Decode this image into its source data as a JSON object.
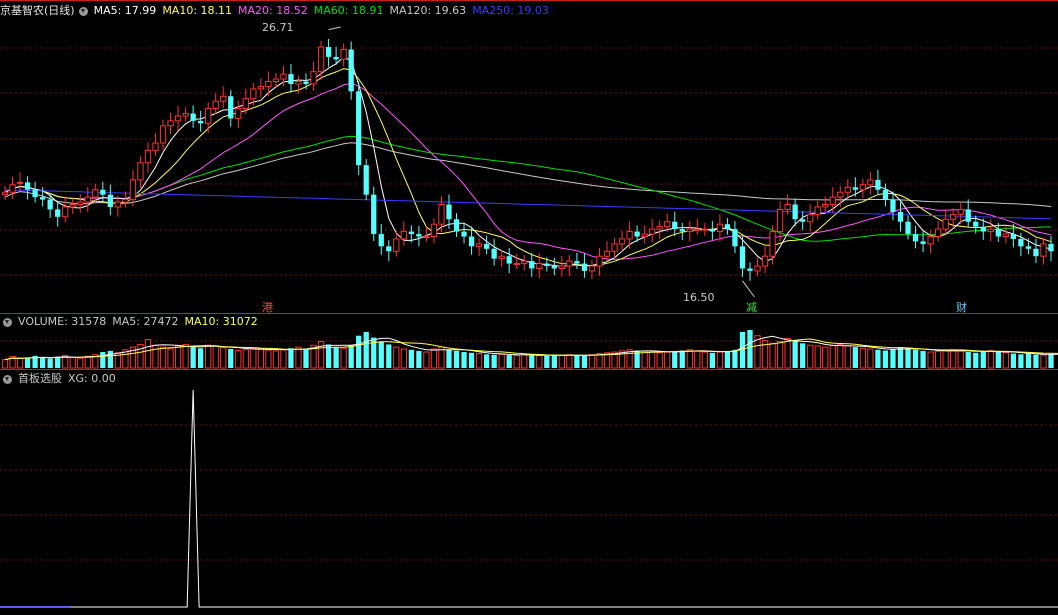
{
  "header": {
    "stock_name": "京基智农",
    "period": "(日线)",
    "ma5": "MA5: 17.99",
    "ma10": "MA10: 18.11",
    "ma20": "MA20: 18.52",
    "ma60": "MA60: 18.91",
    "ma120": "MA120: 19.63",
    "ma250": "MA250: 19.03"
  },
  "volume_header": {
    "volume": "VOLUME: 31578",
    "ma5": "MA5: 27472",
    "ma10": "MA10: 31072"
  },
  "indicator_header": {
    "name": "首板选股",
    "xg": "XG: 0.00"
  },
  "annotations": {
    "high_label": "26.71",
    "low_label": "16.50",
    "marker_1": "港",
    "marker_2": "减",
    "marker_3": "财"
  },
  "colors": {
    "up": "#ff3232",
    "down": "#54ffff",
    "ma5": "#ffffff",
    "ma10": "#ffff55",
    "ma20": "#ff55ff",
    "ma60": "#00e000",
    "ma120": "#c8c8c8",
    "ma250": "#3c3cff",
    "grid": "#7a1010",
    "panel_border": "#c81e1e"
  },
  "chart_data": [
    {
      "type": "candlestick",
      "title": "京基智农 (日线)",
      "ylim": [
        15.8,
        27.1
      ],
      "grid": true,
      "annotations": [
        {
          "label": "26.71",
          "value": 26.71
        },
        {
          "label": "16.50",
          "value": 16.5
        }
      ],
      "moving_averages": [
        {
          "name": "MA5",
          "value": 17.99
        },
        {
          "name": "MA10",
          "value": 18.11
        },
        {
          "name": "MA20",
          "value": 18.52
        },
        {
          "name": "MA60",
          "value": 18.91
        },
        {
          "name": "MA120",
          "value": 19.63
        },
        {
          "name": "MA250",
          "value": 19.03
        }
      ],
      "close": [
        20.1,
        20.4,
        20.5,
        20.2,
        19.9,
        19.8,
        19.4,
        19.1,
        19.5,
        19.6,
        19.7,
        19.9,
        20.2,
        20.0,
        19.5,
        19.7,
        19.8,
        20.6,
        21.3,
        21.8,
        22.1,
        22.8,
        23.0,
        23.2,
        23.3,
        23.0,
        22.9,
        23.5,
        23.8,
        24.0,
        23.1,
        23.5,
        23.9,
        24.3,
        24.4,
        24.6,
        24.7,
        24.9,
        24.5,
        24.6,
        24.5,
        25.0,
        26.0,
        25.6,
        25.5,
        25.9,
        24.2,
        21.2,
        20.0,
        18.4,
        17.9,
        17.7,
        18.2,
        18.5,
        18.4,
        18.3,
        18.3,
        18.8,
        19.6,
        19.0,
        18.5,
        18.3,
        17.9,
        18.0,
        17.8,
        17.4,
        17.5,
        17.2,
        17.2,
        17.3,
        17.0,
        17.2,
        17.1,
        17.0,
        17.1,
        17.3,
        17.2,
        16.9,
        17.1,
        17.5,
        17.7,
        18.0,
        18.2,
        18.5,
        18.3,
        18.4,
        18.6,
        18.7,
        18.9,
        18.6,
        18.5,
        18.6,
        18.6,
        18.6,
        18.5,
        18.8,
        18.6,
        17.9,
        17.0,
        16.9,
        17.1,
        17.5,
        18.5,
        19.4,
        19.6,
        19.0,
        18.9,
        19.2,
        19.5,
        19.6,
        19.9,
        20.1,
        20.3,
        20.2,
        20.4,
        20.6,
        20.2,
        19.8,
        19.3,
        18.9,
        18.4,
        18.1,
        18.0,
        18.3,
        18.6,
        19.0,
        19.2,
        19.4,
        18.9,
        18.7,
        18.5,
        18.6,
        18.3,
        18.4,
        18.2,
        17.9,
        17.8,
        17.5,
        18.0,
        17.7
      ],
      "open": [
        20.0,
        20.1,
        20.5,
        20.5,
        20.2,
        19.9,
        19.8,
        19.4,
        19.1,
        19.5,
        19.6,
        19.7,
        19.9,
        20.2,
        20.0,
        19.5,
        19.7,
        19.8,
        20.6,
        21.3,
        21.8,
        22.1,
        22.8,
        23.0,
        23.2,
        23.3,
        23.0,
        22.9,
        23.5,
        23.8,
        24.0,
        23.1,
        23.5,
        23.9,
        24.3,
        24.4,
        24.6,
        24.7,
        24.9,
        24.5,
        24.6,
        24.5,
        25.0,
        26.0,
        25.6,
        25.5,
        25.9,
        24.2,
        21.2,
        20.0,
        18.4,
        17.9,
        17.7,
        18.2,
        18.5,
        18.4,
        18.3,
        18.3,
        18.8,
        19.6,
        19.0,
        18.5,
        18.3,
        17.9,
        18.0,
        17.8,
        17.4,
        17.5,
        17.2,
        17.2,
        17.3,
        17.0,
        17.2,
        17.1,
        17.0,
        17.1,
        17.3,
        17.2,
        16.9,
        17.1,
        17.5,
        17.7,
        18.0,
        18.2,
        18.5,
        18.3,
        18.4,
        18.6,
        18.7,
        18.9,
        18.6,
        18.5,
        18.6,
        18.6,
        18.6,
        18.5,
        18.8,
        18.6,
        17.9,
        17.0,
        16.9,
        17.1,
        17.5,
        18.5,
        19.4,
        19.6,
        19.0,
        18.9,
        19.2,
        19.5,
        19.6,
        19.9,
        20.1,
        20.3,
        20.2,
        20.4,
        20.6,
        20.2,
        19.8,
        19.3,
        18.9,
        18.4,
        18.1,
        18.0,
        18.3,
        18.6,
        19.0,
        19.2,
        19.4,
        18.9,
        18.7,
        18.5,
        18.6,
        18.3,
        18.4,
        18.2,
        17.9,
        17.8,
        17.5,
        18.0
      ]
    },
    {
      "type": "bar",
      "title": "VOLUME",
      "series": [
        {
          "name": "VOLUME",
          "last": 31578
        },
        {
          "name": "MA5",
          "last": 27472
        },
        {
          "name": "MA10",
          "last": 31072
        }
      ],
      "relative_values": [
        0.22,
        0.3,
        0.25,
        0.28,
        0.32,
        0.27,
        0.25,
        0.3,
        0.33,
        0.28,
        0.26,
        0.31,
        0.35,
        0.42,
        0.45,
        0.4,
        0.48,
        0.55,
        0.62,
        0.75,
        0.6,
        0.55,
        0.5,
        0.58,
        0.62,
        0.55,
        0.52,
        0.6,
        0.58,
        0.54,
        0.5,
        0.46,
        0.48,
        0.52,
        0.5,
        0.47,
        0.45,
        0.48,
        0.52,
        0.55,
        0.5,
        0.6,
        0.7,
        0.62,
        0.55,
        0.52,
        0.6,
        0.85,
        0.95,
        0.8,
        0.7,
        0.62,
        0.55,
        0.5,
        0.48,
        0.45,
        0.42,
        0.5,
        0.55,
        0.48,
        0.45,
        0.42,
        0.4,
        0.38,
        0.36,
        0.35,
        0.36,
        0.34,
        0.33,
        0.35,
        0.34,
        0.33,
        0.32,
        0.34,
        0.33,
        0.35,
        0.34,
        0.33,
        0.35,
        0.38,
        0.4,
        0.42,
        0.45,
        0.48,
        0.46,
        0.44,
        0.42,
        0.4,
        0.42,
        0.44,
        0.46,
        0.48,
        0.45,
        0.42,
        0.4,
        0.42,
        0.45,
        0.48,
        0.95,
        1.0,
        0.85,
        0.72,
        0.65,
        0.7,
        0.78,
        0.72,
        0.65,
        0.6,
        0.58,
        0.55,
        0.6,
        0.62,
        0.58,
        0.55,
        0.52,
        0.5,
        0.48,
        0.46,
        0.5,
        0.55,
        0.52,
        0.48,
        0.45,
        0.42,
        0.44,
        0.46,
        0.48,
        0.45,
        0.42,
        0.4,
        0.44,
        0.46,
        0.42,
        0.4,
        0.38,
        0.36,
        0.38,
        0.35,
        0.34,
        0.36,
        0.38,
        0.35
      ]
    },
    {
      "type": "line",
      "title": "首板选股",
      "series": [
        {
          "name": "XG",
          "last": 0.0,
          "spike_index": 25,
          "spike_value": 1
        }
      ]
    }
  ]
}
